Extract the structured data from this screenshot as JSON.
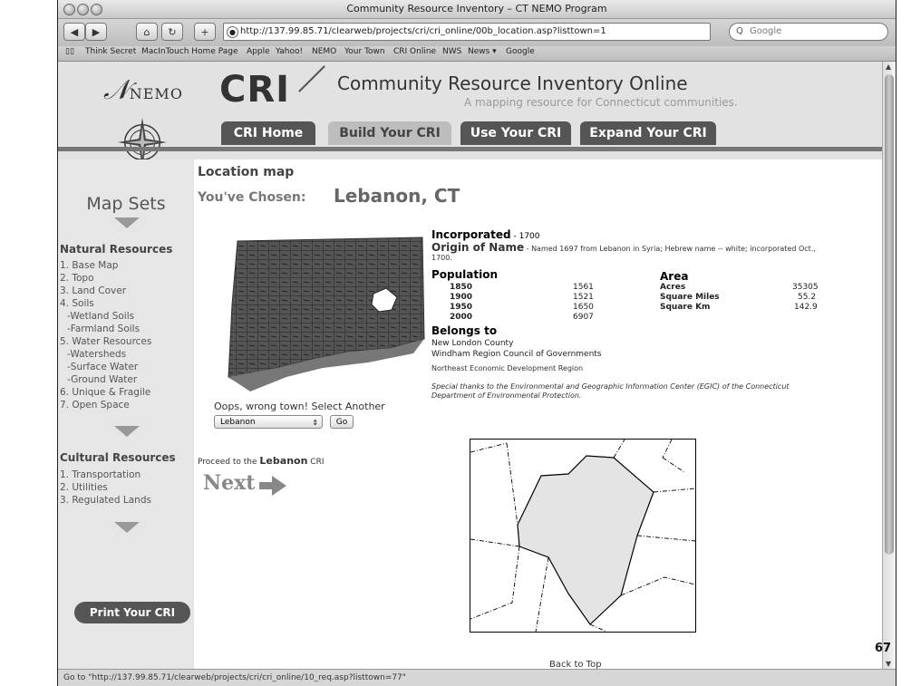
{
  "window": {
    "title": "Community Resource Inventory – CT NEMO Program"
  },
  "toolbar": {
    "back": "◀",
    "forward": "▶",
    "home": "⌂",
    "reload": "↻",
    "add": "+",
    "url": "http://137.99.85.71/clearweb/projects/cri/cri_online/00b_location.asp?listtown=1",
    "search_placeholder": "Google"
  },
  "bookmarks": [
    "Think Secret",
    "MacInTouch Home Page",
    "Apple",
    "Yahoo!",
    "NEMO",
    "Your Town",
    "CRI Online",
    "NWS",
    "News ▾",
    "Google"
  ],
  "header": {
    "nemo": "NEMO",
    "cri": "CRI",
    "title": "Community Resource Inventory Online",
    "subtitle": "A mapping resource for Connecticut communities.",
    "tabs": [
      "CRI Home",
      "Build Your CRI",
      "Use Your CRI",
      "Expand Your CRI"
    ]
  },
  "sidebar": {
    "map_sets": "Map Sets",
    "natural_heading": "Natural Resources",
    "natural_items": [
      "1. Base Map",
      "2. Topo",
      "3. Land Cover",
      "4. Soils",
      "-Wetland Soils",
      "-Farmland Soils",
      "5. Water Resources",
      "-Watersheds",
      "-Surface Water",
      "-Ground Water",
      "6. Unique & Fragile",
      "7. Open Space"
    ],
    "cultural_heading": "Cultural Resources",
    "cultural_items": [
      "1. Transportation",
      "2. Utilities",
      "3. Regulated Lands"
    ],
    "print": "Print Your CRI"
  },
  "main": {
    "heading": "Location map",
    "chosen_label": "You've Chosen:",
    "town": "Lebanon, CT",
    "incorporated_label": "Incorporated",
    "incorporated_value": "- 1700",
    "origin_label": "Origin of Name",
    "origin_value": "- Named 1697 from Lebanon in Syria; Hebrew name -- white; incorporated Oct., 1700.",
    "population_label": "Population",
    "population": [
      {
        "year": "1850",
        "value": "1561"
      },
      {
        "year": "1900",
        "value": "1521"
      },
      {
        "year": "1950",
        "value": "1650"
      },
      {
        "year": "2000",
        "value": "6907"
      }
    ],
    "area_label": "Area",
    "area": [
      {
        "label": "Acres",
        "value": "35305"
      },
      {
        "label": "Square Miles",
        "value": "55.2"
      },
      {
        "label": "Square Km",
        "value": "142.9"
      }
    ],
    "belongs_label": "Belongs to",
    "belongs": [
      "New London County",
      "Windham Region Council of Governments",
      "Northeast Economic Development Region"
    ],
    "thanks": "Special thanks to the Environmental and Geographic Information Center (EGIC) of the Connecticut Department of Environmental Protection.",
    "oops": "Oops, wrong town! Select Another",
    "select_value": "Lebanon",
    "go": "Go",
    "proceed_prefix": "Proceed to the",
    "proceed_town": "Lebanon",
    "proceed_suffix": "CRI",
    "next": "Next",
    "back_to_top": "Back to Top"
  },
  "status": "Go to \"http://137.99.85.71/clearweb/projects/cri/cri_online/10_req.asp?listtown=77\"",
  "page_number": "67",
  "colors": {
    "nav_dark": "#555555",
    "header_bg": "#e2e2e2",
    "sidebar_bg": "#e6e6e6",
    "town_fill": "#e4e4e4"
  }
}
